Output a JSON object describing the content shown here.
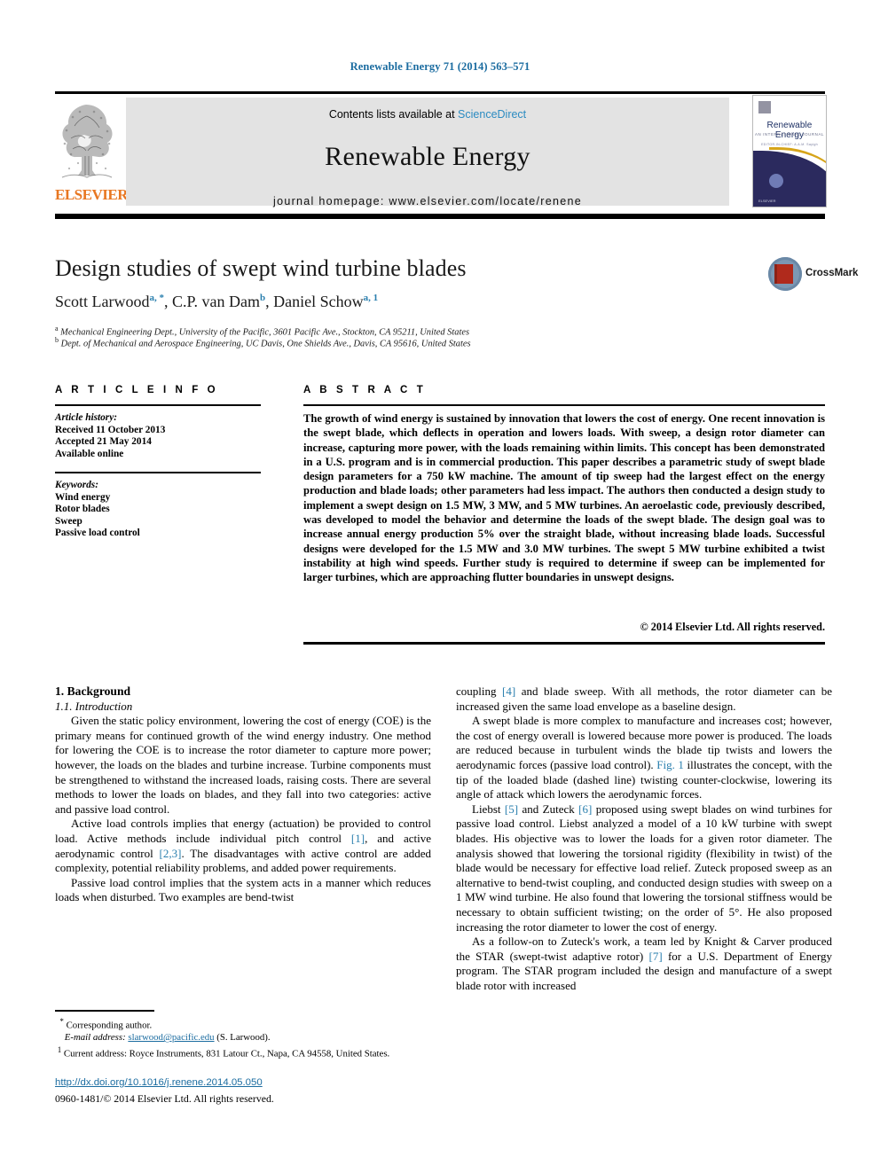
{
  "running_head": "Renewable Energy 71 (2014) 563–571",
  "masthead": {
    "publisher_logo_text": "ELSEVIER",
    "contents_line_prefix": "Contents lists available at ",
    "contents_link": "ScienceDirect",
    "journal_title": "Renewable Energy",
    "homepage_line": "journal homepage: www.elsevier.com/locate/renene",
    "cover": {
      "title": "Renewable Energy",
      "subtitle": "AN INTERNATIONAL JOURNAL",
      "subtitle2": "EDITOR-IN-CHIEF: A.A.M. Sayigh",
      "footer": "ELSEVIER"
    }
  },
  "article": {
    "title": "Design studies of swept wind turbine blades",
    "authors_plain": "Scott Larwood a, *, C.P. van Dam b, Daniel Schow a, 1",
    "authors": [
      {
        "name": "Scott Larwood",
        "marks": "a, *"
      },
      {
        "name": "C.P. van Dam",
        "marks": "b"
      },
      {
        "name": "Daniel Schow",
        "marks": "a, 1"
      }
    ],
    "affiliations": [
      {
        "mark": "a",
        "text": "Mechanical Engineering Dept., University of the Pacific, 3601 Pacific Ave., Stockton, CA 95211, United States"
      },
      {
        "mark": "b",
        "text": "Dept. of Mechanical and Aerospace Engineering, UC Davis, One Shields Ave., Davis, CA 95616, United States"
      }
    ],
    "crossmark_label": "CrossMark"
  },
  "info": {
    "heading": "A R T I C L E    I N F O",
    "history_label": "Article history:",
    "history": [
      "Received 11 October 2013",
      "Accepted 21 May 2014",
      "Available online"
    ],
    "keywords_label": "Keywords:",
    "keywords": [
      "Wind energy",
      "Rotor blades",
      "Sweep",
      "Passive load control"
    ]
  },
  "abstract": {
    "heading": "A B S T R A C T",
    "text": "The growth of wind energy is sustained by innovation that lowers the cost of energy. One recent innovation is the swept blade, which deflects in operation and lowers loads. With sweep, a design rotor diameter can increase, capturing more power, with the loads remaining within limits. This concept has been demonstrated in a U.S. program and is in commercial production. This paper describes a parametric study of swept blade design parameters for a 750 kW machine. The amount of tip sweep had the largest effect on the energy production and blade loads; other parameters had less impact. The authors then conducted a design study to implement a swept design on 1.5 MW, 3 MW, and 5 MW turbines. An aeroelastic code, previously described, was developed to model the behavior and determine the loads of the swept blade. The design goal was to increase annual energy production 5% over the straight blade, without increasing blade loads. Successful designs were developed for the 1.5 MW and 3.0 MW turbines. The swept 5 MW turbine exhibited a twist instability at high wind speeds. Further study is required to determine if sweep can be implemented for larger turbines, which are approaching flutter boundaries in unswept designs.",
    "copyright": "© 2014 Elsevier Ltd. All rights reserved."
  },
  "body": {
    "section_number_title": "1. Background",
    "subsection_number_title": "1.1. Introduction",
    "left_paragraphs": [
      "Given the static policy environment, lowering the cost of energy (COE) is the primary means for continued growth of the wind energy industry. One method for lowering the COE is to increase the rotor diameter to capture more power; however, the loads on the blades and turbine increase. Turbine components must be strengthened to withstand the increased loads, raising costs. There are several methods to lower the loads on blades, and they fall into two categories: active and passive load control.",
      "Active load controls implies that energy (actuation) be provided to control load. Active methods include individual pitch control [1], and active aerodynamic control [2,3]. The disadvantages with active control are added complexity, potential reliability problems, and added power requirements.",
      "Passive load control implies that the system acts in a manner which reduces loads when disturbed. Two examples are bend-twist"
    ],
    "right_paragraphs": [
      "coupling [4] and blade sweep. With all methods, the rotor diameter can be increased given the same load envelope as a baseline design.",
      "A swept blade is more complex to manufacture and increases cost; however, the cost of energy overall is lowered because more power is produced. The loads are reduced because in turbulent winds the blade tip twists and lowers the aerodynamic forces (passive load control). Fig. 1 illustrates the concept, with the tip of the loaded blade (dashed line) twisting counter-clockwise, lowering its angle of attack which lowers the aerodynamic forces.",
      "Liebst [5] and Zuteck [6] proposed using swept blades on wind turbines for passive load control. Liebst analyzed a model of a 10 kW turbine with swept blades. His objective was to lower the loads for a given rotor diameter. The analysis showed that lowering the torsional rigidity (flexibility in twist) of the blade would be necessary for effective load relief. Zuteck proposed sweep as an alternative to bend-twist coupling, and conducted design studies with sweep on a 1 MW wind turbine. He also found that lowering the torsional stiffness would be necessary to obtain sufficient twisting; on the order of 5°. He also proposed increasing the rotor diameter to lower the cost of energy.",
      "As a follow-on to Zuteck's work, a team led by Knight & Carver produced the STAR (swept-twist adaptive rotor) [7] for a U.S. Department of Energy program. The STAR program included the design and manufacture of a swept blade rotor with increased"
    ]
  },
  "footnotes": {
    "corresponding_mark": "*",
    "corresponding": "Corresponding author.",
    "email_label": "E-mail address:",
    "email": "slarwood@pacific.edu",
    "email_owner": "(S. Larwood).",
    "note1_mark": "1",
    "note1": "Current address: Royce Instruments, 831 Latour Ct., Napa, CA 94558, United States."
  },
  "footer": {
    "doi": "http://dx.doi.org/10.1016/j.renene.2014.05.050",
    "issn_line": "0960-1481/© 2014 Elsevier Ltd. All rights reserved."
  },
  "colors": {
    "link": "#1b6ca0",
    "reference": "#2a7fae",
    "masthead_bg": "#e3e3e3",
    "elsevier_orange": "#E87722",
    "cover_navy": "#2b2a5e"
  }
}
